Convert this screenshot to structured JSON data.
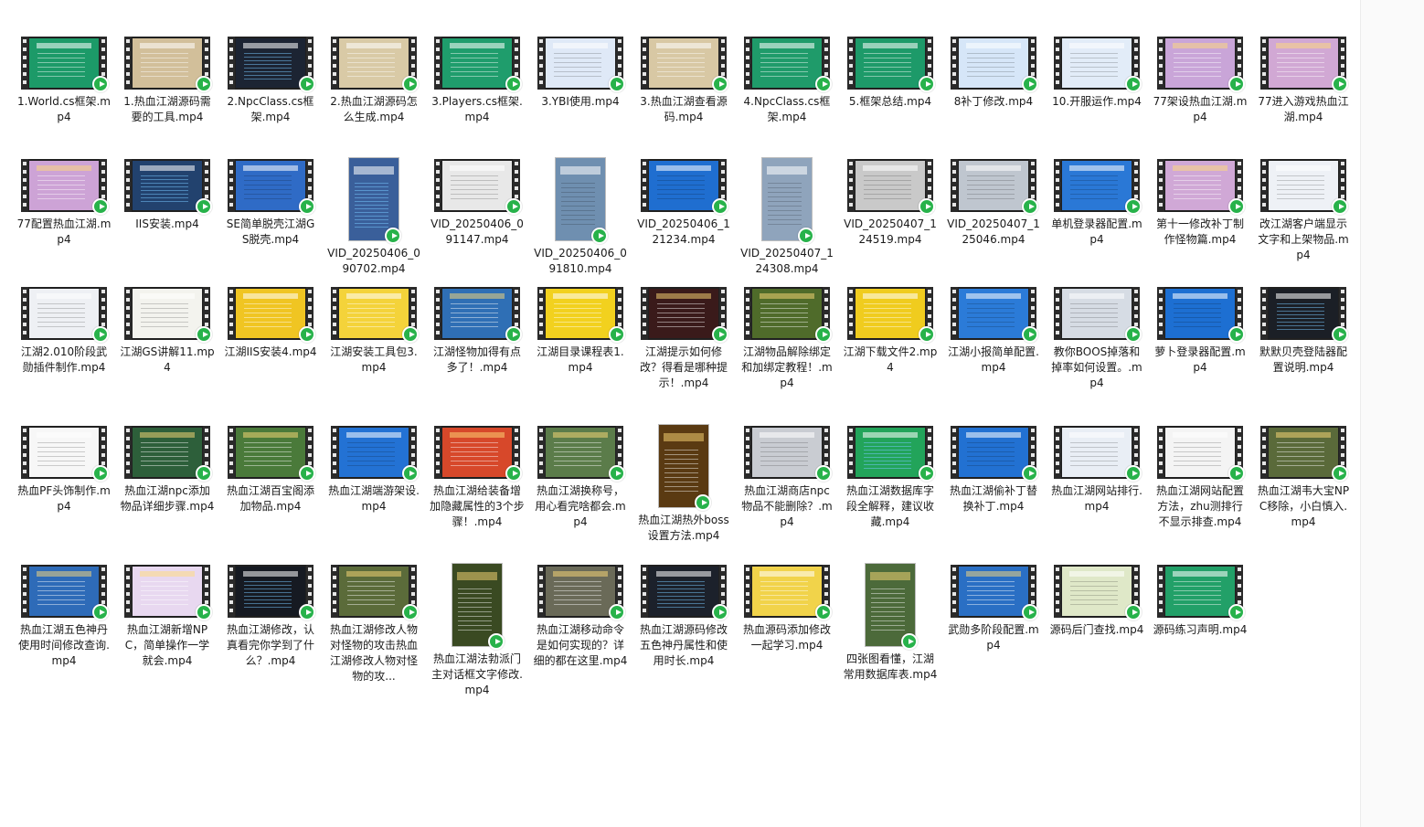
{
  "files": [
    {
      "name": "1.World.cs框架.mp4",
      "bg": "#1c9a68",
      "kind": "slide",
      "shape": "land"
    },
    {
      "name": "1.热血江湖源码需要的工具.mp4",
      "bg": "#d2bf9a",
      "kind": "slide",
      "shape": "land"
    },
    {
      "name": "2.NpcClass.cs框架.mp4",
      "bg": "#1c2433",
      "kind": "dark",
      "shape": "land"
    },
    {
      "name": "2.热血江湖源码怎么生成.mp4",
      "bg": "#d9caa6",
      "kind": "slide",
      "shape": "land"
    },
    {
      "name": "3.Players.cs框架.mp4",
      "bg": "#1f9d6c",
      "kind": "slide",
      "shape": "land"
    },
    {
      "name": "3.YBI使用.mp4",
      "bg": "#dfe9f7",
      "kind": "light",
      "shape": "land"
    },
    {
      "name": "3.热血江湖查看源码.mp4",
      "bg": "#d8c8a4",
      "kind": "slide",
      "shape": "land"
    },
    {
      "name": "4.NpcClass.cs框架.mp4",
      "bg": "#1f9b6a",
      "kind": "slide",
      "shape": "land"
    },
    {
      "name": "5.框架总结.mp4",
      "bg": "#1d9a69",
      "kind": "slide",
      "shape": "land"
    },
    {
      "name": "8补丁修改.mp4",
      "bg": "#d6e6f8",
      "kind": "light",
      "shape": "land"
    },
    {
      "name": "10.开服运作.mp4",
      "bg": "#e2ecf8",
      "kind": "light",
      "shape": "land"
    },
    {
      "name": "77架设热血江湖.mp4",
      "bg": "#c9a5d8",
      "kind": "game",
      "shape": "land"
    },
    {
      "name": "77进入游戏热血江湖.mp4",
      "bg": "#d1a8d4",
      "kind": "game",
      "shape": "land"
    },
    {
      "name": "77配置热血江湖.mp4",
      "bg": "#cda3d6",
      "kind": "game",
      "shape": "land"
    },
    {
      "name": "IIS安装.mp4",
      "bg": "#22426e",
      "kind": "dark",
      "shape": "land"
    },
    {
      "name": "SE简单脱壳江湖GS脱壳.mp4",
      "bg": "#2f6bc6",
      "kind": "light",
      "shape": "land"
    },
    {
      "name": "VID_20250406_090702.mp4",
      "bg": "#3a5f9a",
      "kind": "dark",
      "shape": "portrait"
    },
    {
      "name": "VID_20250406_091147.mp4",
      "bg": "#e8e8e8",
      "kind": "light",
      "shape": "land"
    },
    {
      "name": "VID_20250406_091810.mp4",
      "bg": "#6f8fb0",
      "kind": "light",
      "shape": "portrait"
    },
    {
      "name": "VID_20250406_121234.mp4",
      "bg": "#1f6ed0",
      "kind": "light",
      "shape": "land"
    },
    {
      "name": "VID_20250407_124308.mp4",
      "bg": "#8fa4bc",
      "kind": "light",
      "shape": "portrait"
    },
    {
      "name": "VID_20250407_124519.mp4",
      "bg": "#c9c9c9",
      "kind": "light",
      "shape": "land"
    },
    {
      "name": "VID_20250407_125046.mp4",
      "bg": "#bfc6cf",
      "kind": "light",
      "shape": "land"
    },
    {
      "name": "单机登录器配置.mp4",
      "bg": "#2a78d6",
      "kind": "light",
      "shape": "land"
    },
    {
      "name": "第十一修改补丁制作怪物篇.mp4",
      "bg": "#d0a8d6",
      "kind": "game",
      "shape": "land"
    },
    {
      "name": "改江湖客户端显示文字和上架物品.mp4",
      "bg": "#eef1f6",
      "kind": "light",
      "shape": "land"
    },
    {
      "name": "江湖2.010阶段武勋插件制作.mp4",
      "bg": "#eef0f4",
      "kind": "light",
      "shape": "land"
    },
    {
      "name": "江湖GS讲解11.mp4",
      "bg": "#f3f3ee",
      "kind": "light",
      "shape": "land"
    },
    {
      "name": "江湖IIS安装4.mp4",
      "bg": "#f0c522",
      "kind": "slide",
      "shape": "land"
    },
    {
      "name": "江湖安装工具包3.mp4",
      "bg": "#f4d33a",
      "kind": "slide",
      "shape": "land"
    },
    {
      "name": "江湖怪物加得有点多了！.mp4",
      "bg": "#2f6fb5",
      "kind": "game",
      "shape": "land"
    },
    {
      "name": "江湖目录课程表1.mp4",
      "bg": "#f2d11e",
      "kind": "slide",
      "shape": "land"
    },
    {
      "name": "江湖提示如何修改？得看是哪种提示！.mp4",
      "bg": "#3a1a1a",
      "kind": "game",
      "shape": "land"
    },
    {
      "name": "江湖物品解除绑定和加绑定教程！.mp4",
      "bg": "#4f6b2a",
      "kind": "game",
      "shape": "land"
    },
    {
      "name": "江湖下载文件2.mp4",
      "bg": "#f0cc1e",
      "kind": "slide",
      "shape": "land"
    },
    {
      "name": "江湖小报简单配置.mp4",
      "bg": "#2b7bd8",
      "kind": "light",
      "shape": "land"
    },
    {
      "name": "教你BOOS掉落和掉率如何设置。.mp4",
      "bg": "#d6dce4",
      "kind": "light",
      "shape": "land"
    },
    {
      "name": "萝卜登录器配置.mp4",
      "bg": "#1d6fd2",
      "kind": "light",
      "shape": "land"
    },
    {
      "name": "默默贝壳登陆器配置说明.mp4",
      "bg": "#1b1f26",
      "kind": "dark",
      "shape": "land"
    },
    {
      "name": "热血PF头饰制作.mp4",
      "bg": "#f7f7f7",
      "kind": "light",
      "shape": "land"
    },
    {
      "name": "热血江湖npc添加物品详细步骤.mp4",
      "bg": "#2d5f3a",
      "kind": "game",
      "shape": "land"
    },
    {
      "name": "热血江湖百宝阁添加物品.mp4",
      "bg": "#4a7a3a",
      "kind": "game",
      "shape": "land"
    },
    {
      "name": "热血江湖端游架设.mp4",
      "bg": "#2372d4",
      "kind": "light",
      "shape": "land"
    },
    {
      "name": "热血江湖给装备增加隐藏属性的3个步骤！.mp4",
      "bg": "#d7482a",
      "kind": "game",
      "shape": "land"
    },
    {
      "name": "热血江湖换称号，用心看完啥都会.mp4",
      "bg": "#5b7c4a",
      "kind": "game",
      "shape": "land"
    },
    {
      "name": "热血江湖热外boss设置方法.mp4",
      "bg": "#5a3a12",
      "kind": "game",
      "shape": "portrait"
    },
    {
      "name": "热血江湖商店npc物品不能删除？.mp4",
      "bg": "#c9ccd2",
      "kind": "light",
      "shape": "land"
    },
    {
      "name": "热血江湖数据库字段全解释，建议收藏.mp4",
      "bg": "#22a45a",
      "kind": "dark",
      "shape": "land"
    },
    {
      "name": "热血江湖偷补丁替换补丁.mp4",
      "bg": "#2271d2",
      "kind": "light",
      "shape": "land"
    },
    {
      "name": "热血江湖网站排行.mp4",
      "bg": "#e9eef5",
      "kind": "light",
      "shape": "land"
    },
    {
      "name": "热血江湖网站配置方法，zhu测排行不显示排查.mp4",
      "bg": "#f4f4f4",
      "kind": "light",
      "shape": "land"
    },
    {
      "name": "热血江湖韦大宝NPC移除，小白慎入.mp4",
      "bg": "#5a6a3a",
      "kind": "game",
      "shape": "land"
    },
    {
      "name": "热血江湖五色神丹使用时间修改查询.mp4",
      "bg": "#2e6bb8",
      "kind": "game",
      "shape": "land"
    },
    {
      "name": "热血江湖新增NPC，简单操作一学就会.mp4",
      "bg": "#e8d8f0",
      "kind": "game",
      "shape": "land"
    },
    {
      "name": "热血江湖修改，认真看完你学到了什么？.mp4",
      "bg": "#161a22",
      "kind": "dark",
      "shape": "land"
    },
    {
      "name": "热血江湖修改人物对怪物的攻击热血江湖修改人物对怪物的攻...",
      "bg": "#5b6b3a",
      "kind": "game",
      "shape": "land"
    },
    {
      "name": "热血江湖法勃派门主对话框文字修改.mp4",
      "bg": "#3a4a22",
      "kind": "game",
      "shape": "portrait"
    },
    {
      "name": "热血江湖移动命令是如何实现的？详细的都在这里.mp4",
      "bg": "#6a6a58",
      "kind": "game",
      "shape": "land"
    },
    {
      "name": "热血江湖源码修改五色神丹属性和使用时长.mp4",
      "bg": "#1c212b",
      "kind": "dark",
      "shape": "land"
    },
    {
      "name": "热血源码添加修改一起学习.mp4",
      "bg": "#f1d34a",
      "kind": "slide",
      "shape": "land"
    },
    {
      "name": "四张图看懂，江湖常用数据库表.mp4",
      "bg": "#4c6a3a",
      "kind": "game",
      "shape": "portrait"
    },
    {
      "name": "武勋多阶段配置.mp4",
      "bg": "#2a6fc4",
      "kind": "game",
      "shape": "land"
    },
    {
      "name": "源码后门查找.mp4",
      "bg": "#dfe8c8",
      "kind": "light",
      "shape": "land"
    },
    {
      "name": "源码练习声明.mp4",
      "bg": "#22a068",
      "kind": "slide",
      "shape": "land"
    }
  ]
}
